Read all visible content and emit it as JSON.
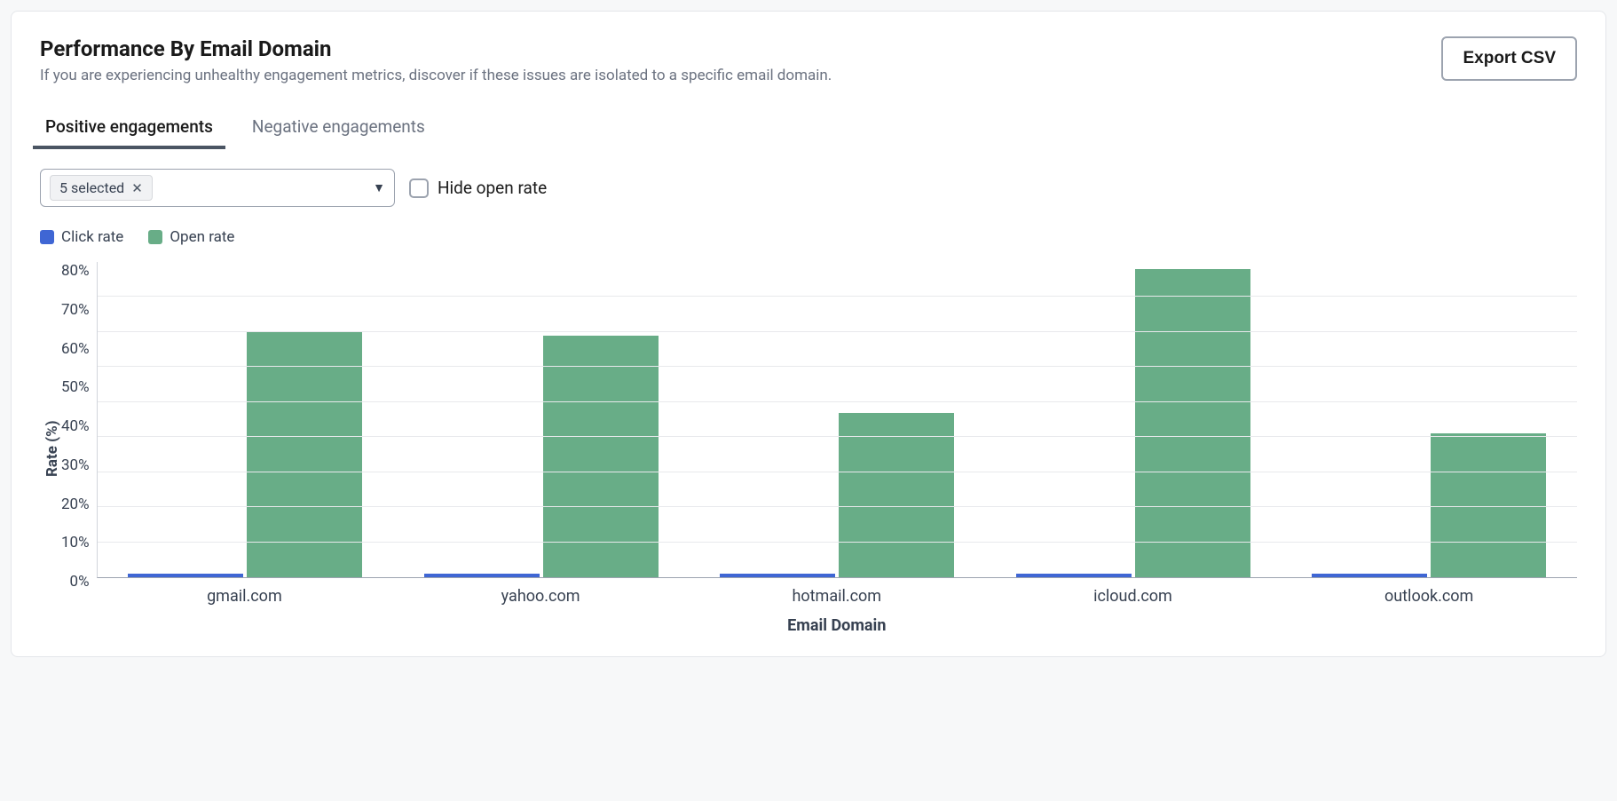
{
  "header": {
    "title": "Performance By Email Domain",
    "subtitle": "If you are experiencing unhealthy engagement metrics, discover if these issues are isolated to a specific email domain.",
    "export_label": "Export CSV"
  },
  "tabs": {
    "positive": "Positive engagements",
    "negative": "Negative engagements",
    "active": "positive"
  },
  "controls": {
    "selected_chip": "5 selected",
    "hide_open_rate_label": "Hide open rate",
    "hide_open_rate_checked": false
  },
  "legend": {
    "click_rate": "Click rate",
    "open_rate": "Open rate"
  },
  "colors": {
    "click_rate": "#3f66d4",
    "open_rate": "#68ad87"
  },
  "chart_data": {
    "type": "bar",
    "xlabel": "Email Domain",
    "ylabel": "Rate (%)",
    "ylim": [
      0,
      90
    ],
    "y_ticks": [
      "0%",
      "10%",
      "20%",
      "30%",
      "40%",
      "50%",
      "60%",
      "70%",
      "80%"
    ],
    "categories": [
      "gmail.com",
      "yahoo.com",
      "hotmail.com",
      "icloud.com",
      "outlook.com"
    ],
    "series": [
      {
        "name": "Click rate",
        "values": [
          1,
          1,
          1,
          1,
          1
        ]
      },
      {
        "name": "Open rate",
        "values": [
          70,
          69,
          47,
          88,
          41
        ]
      }
    ]
  }
}
